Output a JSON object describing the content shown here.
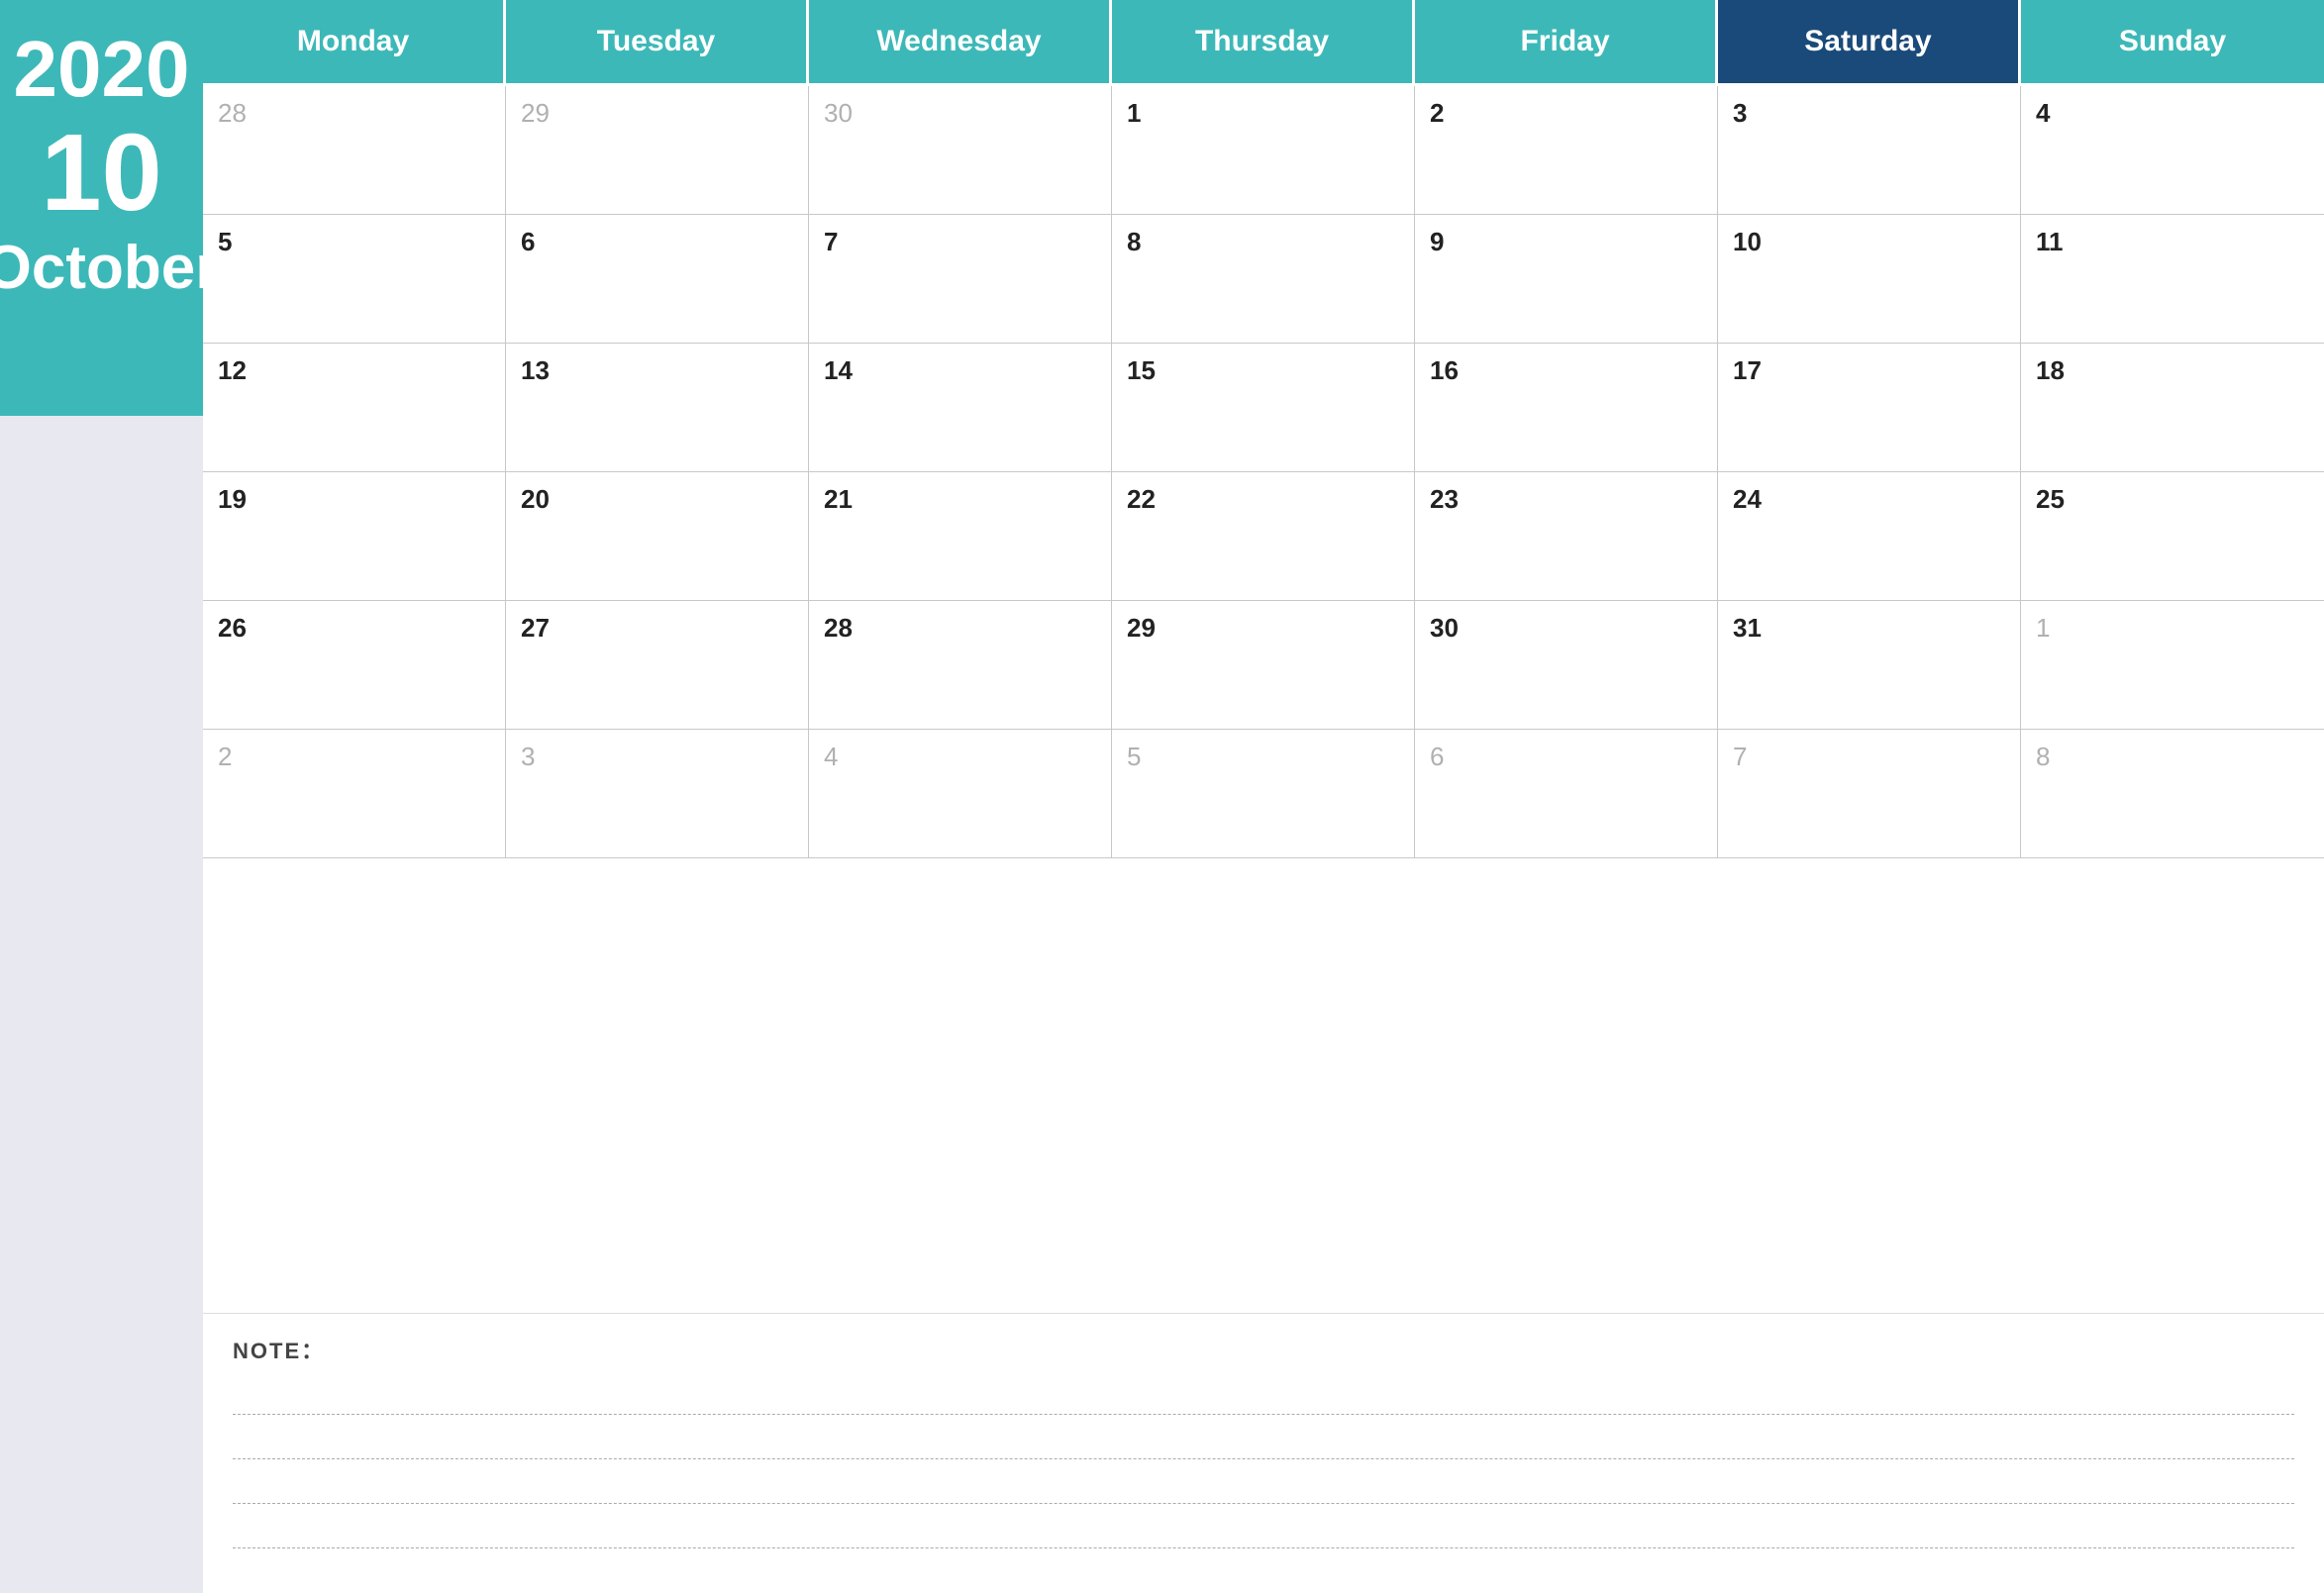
{
  "sidebar": {
    "year": "2020",
    "month_num": "10",
    "month_name": "October"
  },
  "header": {
    "days": [
      {
        "label": "Monday",
        "class": ""
      },
      {
        "label": "Tuesday",
        "class": ""
      },
      {
        "label": "Wednesday",
        "class": ""
      },
      {
        "label": "Thursday",
        "class": ""
      },
      {
        "label": "Friday",
        "class": ""
      },
      {
        "label": "Saturday",
        "class": "saturday"
      },
      {
        "label": "Sunday",
        "class": ""
      }
    ]
  },
  "weeks": [
    [
      {
        "num": "28",
        "other": true
      },
      {
        "num": "29",
        "other": true
      },
      {
        "num": "30",
        "other": true
      },
      {
        "num": "1",
        "other": false
      },
      {
        "num": "2",
        "other": false
      },
      {
        "num": "3",
        "other": false
      },
      {
        "num": "4",
        "other": false
      }
    ],
    [
      {
        "num": "5",
        "other": false
      },
      {
        "num": "6",
        "other": false
      },
      {
        "num": "7",
        "other": false
      },
      {
        "num": "8",
        "other": false
      },
      {
        "num": "9",
        "other": false
      },
      {
        "num": "10",
        "other": false
      },
      {
        "num": "11",
        "other": false
      }
    ],
    [
      {
        "num": "12",
        "other": false
      },
      {
        "num": "13",
        "other": false
      },
      {
        "num": "14",
        "other": false
      },
      {
        "num": "15",
        "other": false
      },
      {
        "num": "16",
        "other": false
      },
      {
        "num": "17",
        "other": false
      },
      {
        "num": "18",
        "other": false
      }
    ],
    [
      {
        "num": "19",
        "other": false
      },
      {
        "num": "20",
        "other": false
      },
      {
        "num": "21",
        "other": false
      },
      {
        "num": "22",
        "other": false
      },
      {
        "num": "23",
        "other": false
      },
      {
        "num": "24",
        "other": false
      },
      {
        "num": "25",
        "other": false
      }
    ],
    [
      {
        "num": "26",
        "other": false
      },
      {
        "num": "27",
        "other": false
      },
      {
        "num": "28",
        "other": false
      },
      {
        "num": "29",
        "other": false
      },
      {
        "num": "30",
        "other": false
      },
      {
        "num": "31",
        "other": false
      },
      {
        "num": "1",
        "other": true
      }
    ],
    [
      {
        "num": "2",
        "other": true
      },
      {
        "num": "3",
        "other": true
      },
      {
        "num": "4",
        "other": true
      },
      {
        "num": "5",
        "other": true
      },
      {
        "num": "6",
        "other": true
      },
      {
        "num": "7",
        "other": true
      },
      {
        "num": "8",
        "other": true
      }
    ]
  ],
  "notes": {
    "label": "NOTE："
  }
}
